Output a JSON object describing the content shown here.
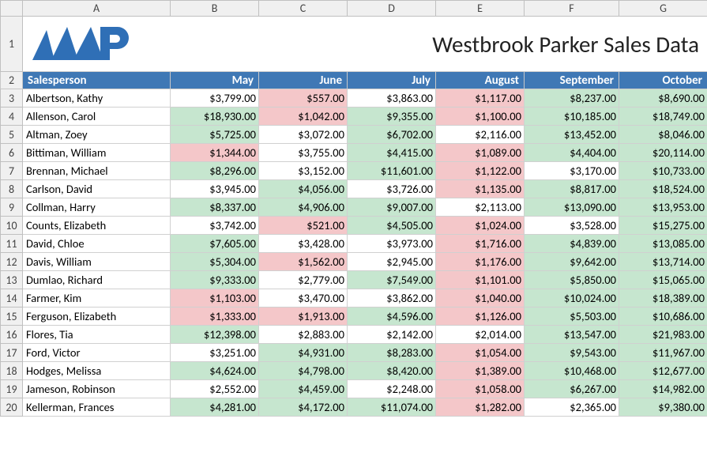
{
  "title": "Westbrook Parker Sales Data",
  "columns_letters": [
    "A",
    "B",
    "C",
    "D",
    "E",
    "F",
    "G"
  ],
  "header": {
    "salesperson": "Salesperson",
    "months": [
      "May",
      "June",
      "July",
      "August",
      "September",
      "October"
    ]
  },
  "green_color": "#c6e6cf",
  "red_color": "#f4c7c9",
  "thresholds_note": "cell coloring appears to be conditional formatting; green = higher values, red = lower values per column",
  "rows": [
    {
      "n": 3,
      "name": "Albertson, Kathy",
      "vals": [
        "$3,799.00",
        "$557.00",
        "$3,863.00",
        "$1,117.00",
        "$8,237.00",
        "$8,690.00"
      ],
      "fmt": [
        "",
        "red",
        "",
        "red",
        "green",
        "green"
      ]
    },
    {
      "n": 4,
      "name": "Allenson, Carol",
      "vals": [
        "$18,930.00",
        "$1,042.00",
        "$9,355.00",
        "$1,100.00",
        "$10,185.00",
        "$18,749.00"
      ],
      "fmt": [
        "green",
        "red",
        "green",
        "red",
        "green",
        "green"
      ]
    },
    {
      "n": 5,
      "name": "Altman, Zoey",
      "vals": [
        "$5,725.00",
        "$3,072.00",
        "$6,702.00",
        "$2,116.00",
        "$13,452.00",
        "$8,046.00"
      ],
      "fmt": [
        "green",
        "",
        "green",
        "",
        "green",
        "green"
      ]
    },
    {
      "n": 6,
      "name": "Bittiman, William",
      "vals": [
        "$1,344.00",
        "$3,755.00",
        "$4,415.00",
        "$1,089.00",
        "$4,404.00",
        "$20,114.00"
      ],
      "fmt": [
        "red",
        "",
        "green",
        "red",
        "green",
        "green"
      ]
    },
    {
      "n": 7,
      "name": "Brennan, Michael",
      "vals": [
        "$8,296.00",
        "$3,152.00",
        "$11,601.00",
        "$1,122.00",
        "$3,170.00",
        "$10,733.00"
      ],
      "fmt": [
        "green",
        "",
        "green",
        "red",
        "",
        "green"
      ]
    },
    {
      "n": 8,
      "name": "Carlson, David",
      "vals": [
        "$3,945.00",
        "$4,056.00",
        "$3,726.00",
        "$1,135.00",
        "$8,817.00",
        "$18,524.00"
      ],
      "fmt": [
        "",
        "green",
        "",
        "red",
        "green",
        "green"
      ]
    },
    {
      "n": 9,
      "name": "Collman, Harry",
      "vals": [
        "$8,337.00",
        "$4,906.00",
        "$9,007.00",
        "$2,113.00",
        "$13,090.00",
        "$13,953.00"
      ],
      "fmt": [
        "green",
        "green",
        "green",
        "",
        "green",
        "green"
      ]
    },
    {
      "n": 10,
      "name": "Counts, Elizabeth",
      "vals": [
        "$3,742.00",
        "$521.00",
        "$4,505.00",
        "$1,024.00",
        "$3,528.00",
        "$15,275.00"
      ],
      "fmt": [
        "",
        "red",
        "green",
        "red",
        "",
        "green"
      ]
    },
    {
      "n": 11,
      "name": "David, Chloe",
      "vals": [
        "$7,605.00",
        "$3,428.00",
        "$3,973.00",
        "$1,716.00",
        "$4,839.00",
        "$13,085.00"
      ],
      "fmt": [
        "green",
        "",
        "",
        "red",
        "green",
        "green"
      ]
    },
    {
      "n": 12,
      "name": "Davis, William",
      "vals": [
        "$5,304.00",
        "$1,562.00",
        "$2,945.00",
        "$1,176.00",
        "$9,642.00",
        "$13,714.00"
      ],
      "fmt": [
        "green",
        "red",
        "",
        "red",
        "green",
        "green"
      ]
    },
    {
      "n": 13,
      "name": "Dumlao, Richard",
      "vals": [
        "$9,333.00",
        "$2,779.00",
        "$7,549.00",
        "$1,101.00",
        "$5,850.00",
        "$15,065.00"
      ],
      "fmt": [
        "green",
        "",
        "green",
        "red",
        "green",
        "green"
      ]
    },
    {
      "n": 14,
      "name": "Farmer, Kim",
      "vals": [
        "$1,103.00",
        "$3,470.00",
        "$3,862.00",
        "$1,040.00",
        "$10,024.00",
        "$18,389.00"
      ],
      "fmt": [
        "red",
        "",
        "",
        "red",
        "green",
        "green"
      ]
    },
    {
      "n": 15,
      "name": "Ferguson, Elizabeth",
      "vals": [
        "$1,333.00",
        "$1,913.00",
        "$4,596.00",
        "$1,126.00",
        "$5,503.00",
        "$10,686.00"
      ],
      "fmt": [
        "red",
        "red",
        "green",
        "red",
        "green",
        "green"
      ]
    },
    {
      "n": 16,
      "name": "Flores, Tia",
      "vals": [
        "$12,398.00",
        "$2,883.00",
        "$2,142.00",
        "$2,014.00",
        "$13,547.00",
        "$21,983.00"
      ],
      "fmt": [
        "green",
        "",
        "",
        "",
        "green",
        "green"
      ]
    },
    {
      "n": 17,
      "name": "Ford, Victor",
      "vals": [
        "$3,251.00",
        "$4,931.00",
        "$8,283.00",
        "$1,054.00",
        "$9,543.00",
        "$11,967.00"
      ],
      "fmt": [
        "",
        "green",
        "green",
        "red",
        "green",
        "green"
      ]
    },
    {
      "n": 18,
      "name": "Hodges, Melissa",
      "vals": [
        "$4,624.00",
        "$4,798.00",
        "$8,420.00",
        "$1,389.00",
        "$10,468.00",
        "$12,677.00"
      ],
      "fmt": [
        "green",
        "green",
        "green",
        "red",
        "green",
        "green"
      ]
    },
    {
      "n": 19,
      "name": "Jameson, Robinson",
      "vals": [
        "$2,552.00",
        "$4,459.00",
        "$2,248.00",
        "$1,058.00",
        "$6,267.00",
        "$14,982.00"
      ],
      "fmt": [
        "",
        "green",
        "",
        "red",
        "green",
        "green"
      ]
    },
    {
      "n": 20,
      "name": "Kellerman, Frances",
      "vals": [
        "$4,281.00",
        "$4,172.00",
        "$11,074.00",
        "$1,282.00",
        "$2,365.00",
        "$9,380.00"
      ],
      "fmt": [
        "green",
        "green",
        "green",
        "red",
        "",
        "green"
      ]
    }
  ],
  "chart_data": {
    "type": "table",
    "title": "Westbrook Parker Sales Data",
    "columns": [
      "Salesperson",
      "May",
      "June",
      "July",
      "August",
      "September",
      "October"
    ],
    "data": [
      [
        "Albertson, Kathy",
        3799.0,
        557.0,
        3863.0,
        1117.0,
        8237.0,
        8690.0
      ],
      [
        "Allenson, Carol",
        18930.0,
        1042.0,
        9355.0,
        1100.0,
        10185.0,
        18749.0
      ],
      [
        "Altman, Zoey",
        5725.0,
        3072.0,
        6702.0,
        2116.0,
        13452.0,
        8046.0
      ],
      [
        "Bittiman, William",
        1344.0,
        3755.0,
        4415.0,
        1089.0,
        4404.0,
        20114.0
      ],
      [
        "Brennan, Michael",
        8296.0,
        3152.0,
        11601.0,
        1122.0,
        3170.0,
        10733.0
      ],
      [
        "Carlson, David",
        3945.0,
        4056.0,
        3726.0,
        1135.0,
        8817.0,
        18524.0
      ],
      [
        "Collman, Harry",
        8337.0,
        4906.0,
        9007.0,
        2113.0,
        13090.0,
        13953.0
      ],
      [
        "Counts, Elizabeth",
        3742.0,
        521.0,
        4505.0,
        1024.0,
        3528.0,
        15275.0
      ],
      [
        "David, Chloe",
        7605.0,
        3428.0,
        3973.0,
        1716.0,
        4839.0,
        13085.0
      ],
      [
        "Davis, William",
        5304.0,
        1562.0,
        2945.0,
        1176.0,
        9642.0,
        13714.0
      ],
      [
        "Dumlao, Richard",
        9333.0,
        2779.0,
        7549.0,
        1101.0,
        5850.0,
        15065.0
      ],
      [
        "Farmer, Kim",
        1103.0,
        3470.0,
        3862.0,
        1040.0,
        10024.0,
        18389.0
      ],
      [
        "Ferguson, Elizabeth",
        1333.0,
        1913.0,
        4596.0,
        1126.0,
        5503.0,
        10686.0
      ],
      [
        "Flores, Tia",
        12398.0,
        2883.0,
        2142.0,
        2014.0,
        13547.0,
        21983.0
      ],
      [
        "Ford, Victor",
        3251.0,
        4931.0,
        8283.0,
        1054.0,
        9543.0,
        11967.0
      ],
      [
        "Hodges, Melissa",
        4624.0,
        4798.0,
        8420.0,
        1389.0,
        10468.0,
        12677.0
      ],
      [
        "Jameson, Robinson",
        2552.0,
        4459.0,
        2248.0,
        1058.0,
        6267.0,
        14982.0
      ],
      [
        "Kellerman, Frances",
        4281.0,
        4172.0,
        11074.0,
        1282.0,
        2365.0,
        9380.0
      ]
    ]
  }
}
